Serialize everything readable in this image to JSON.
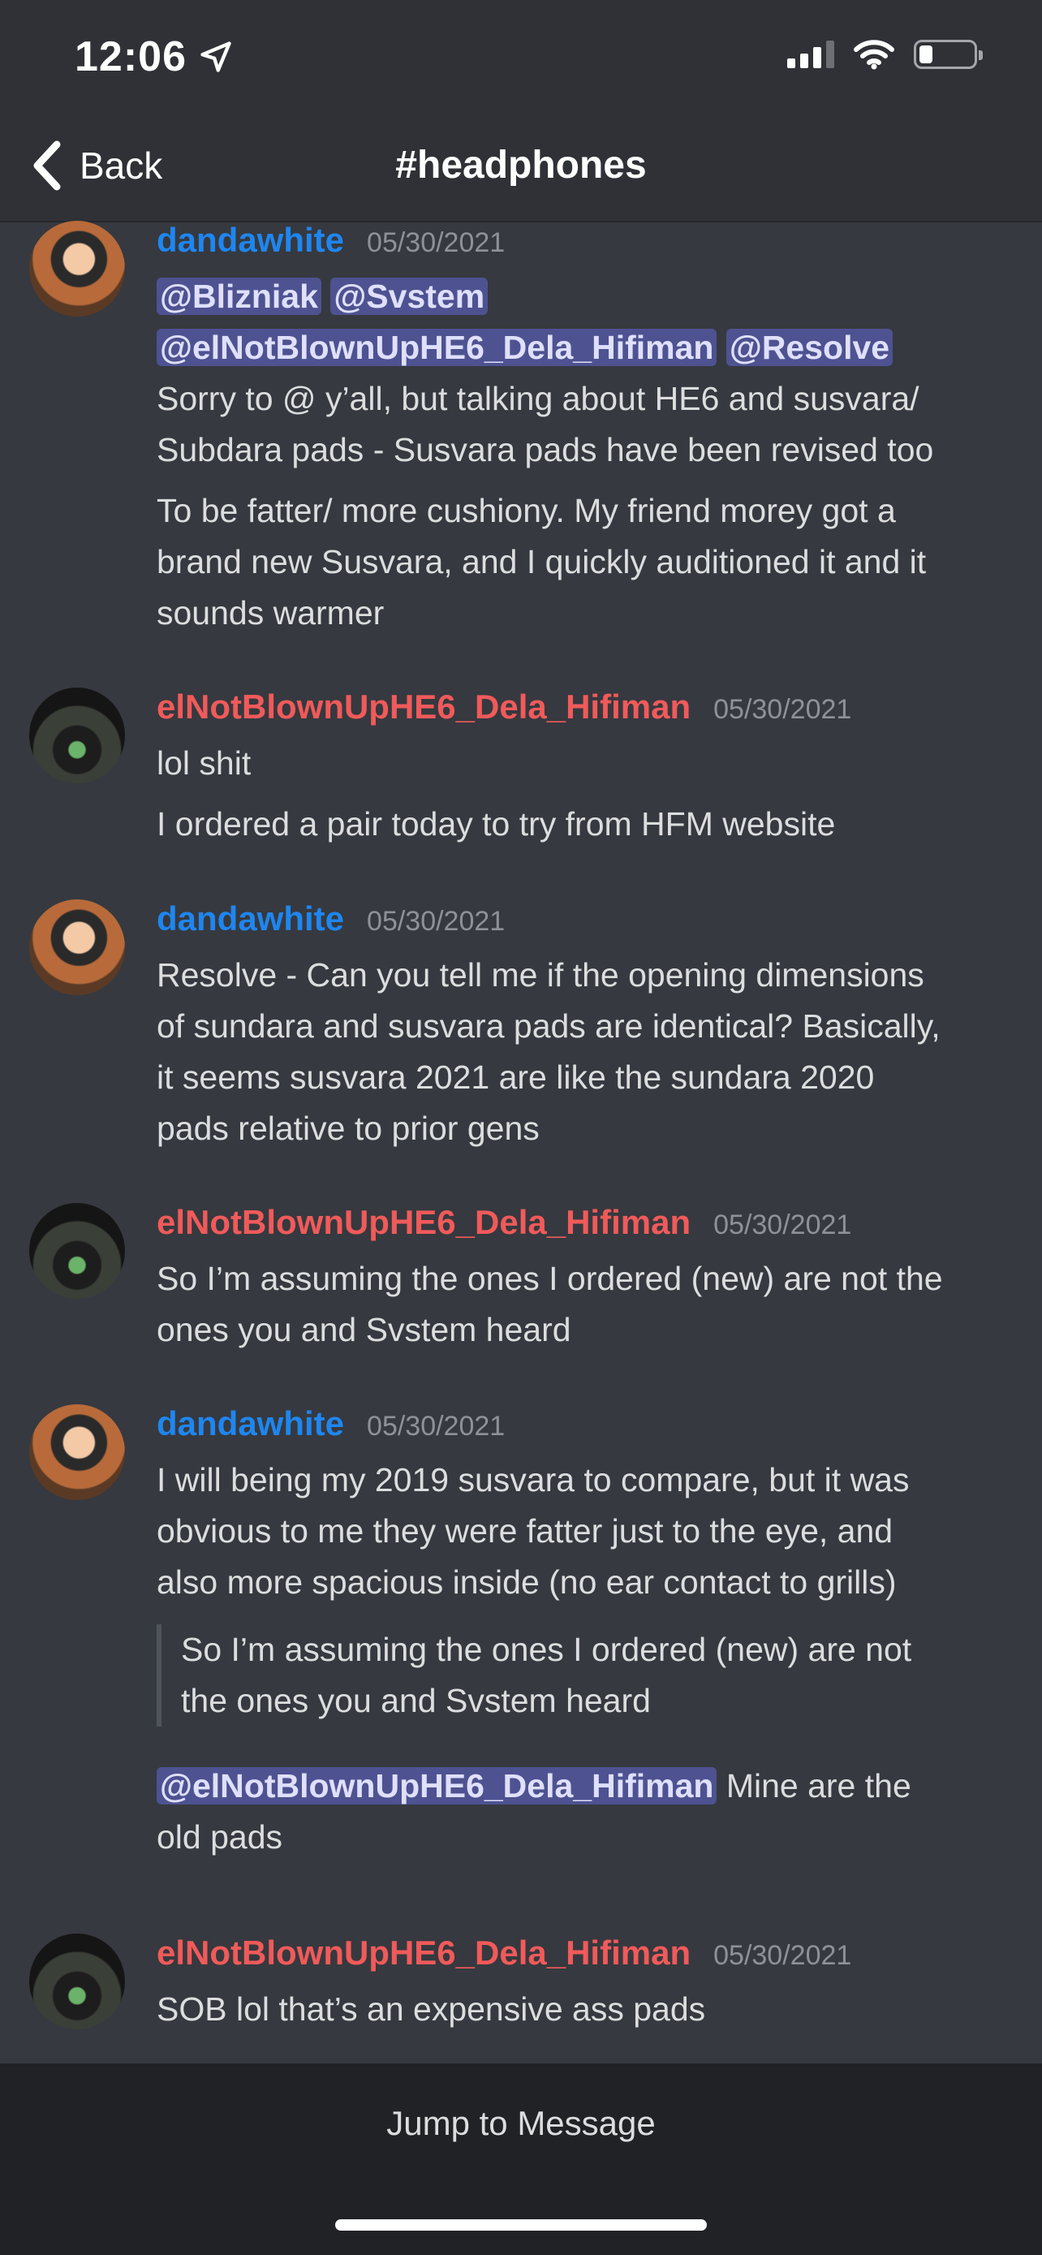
{
  "status_bar": {
    "time": "12:06"
  },
  "nav": {
    "back_label": "Back",
    "channel": "#headphones"
  },
  "messages": [
    {
      "author": "dandawhite",
      "timestamp": "05/30/2021",
      "mentions_line1": [
        "@Blizniak",
        "@Svstem"
      ],
      "mentions_line2": [
        "@elNotBlownUpHE6_Dela_Hifiman",
        "@Resolve"
      ],
      "lines_a": [
        "Sorry to @ y’all, but talking about HE6 and susvara/",
        "Subdara pads - Susvara pads have been revised too"
      ],
      "lines_b": [
        "To be fatter/ more cushiony. My friend morey got a",
        "brand new Susvara, and I quickly auditioned it and it",
        "sounds warmer"
      ]
    },
    {
      "author": "elNotBlownUpHE6_Dela_Hifiman",
      "timestamp": "05/30/2021",
      "lines_a": [
        "lol shit"
      ],
      "lines_b": [
        "I ordered a pair today to try from HFM website"
      ]
    },
    {
      "author": "dandawhite",
      "timestamp": "05/30/2021",
      "lines": [
        "Resolve - Can you tell me if the opening dimensions",
        "of sundara and susvara pads are identical? Basically,",
        "it seems susvara 2021 are like the sundara 2020",
        "pads relative to prior gens"
      ]
    },
    {
      "author": "elNotBlownUpHE6_Dela_Hifiman",
      "timestamp": "05/30/2021",
      "lines": [
        "So I’m assuming the ones I ordered (new) are not the",
        "ones you and Svstem heard"
      ]
    },
    {
      "author": "dandawhite",
      "timestamp": "05/30/2021",
      "lines": [
        "I will being my 2019 susvara to compare, but it was",
        "obvious to me they were fatter just to the eye, and",
        "also more spacious inside (no ear contact to grills)"
      ],
      "quote": [
        "So I’m assuming the ones I ordered (new) are not",
        "the ones you and Svstem heard"
      ],
      "reply_mention": "@elNotBlownUpHE6_Dela_Hifiman",
      "reply_text": "Mine are the",
      "reply_text2": "old pads"
    },
    {
      "author": "elNotBlownUpHE6_Dela_Hifiman",
      "timestamp": "05/30/2021",
      "lines": [
        "SOB lol that’s an expensive ass pads"
      ]
    }
  ],
  "footer": {
    "jump_label": "Jump to Message"
  },
  "colors": {
    "background": "#36393f",
    "mention_bg": "#4e5291",
    "author_blue": "#1e86f0",
    "author_red": "#f05a5a"
  }
}
